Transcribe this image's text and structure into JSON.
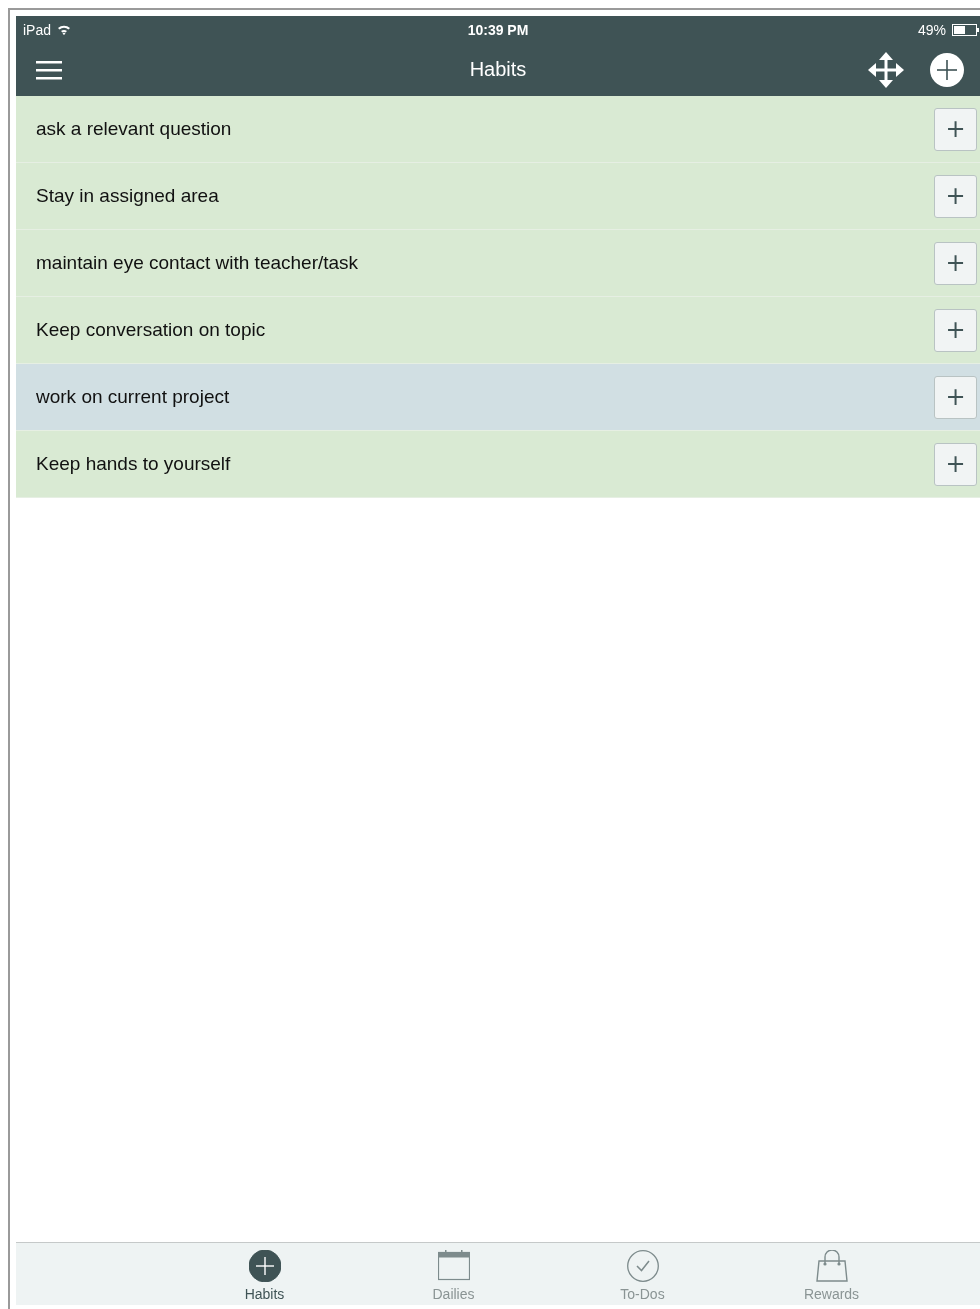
{
  "status_bar": {
    "device": "iPad",
    "time": "10:39 PM",
    "battery": "49%"
  },
  "nav_bar": {
    "title": "Habits"
  },
  "habits": [
    {
      "text": "ask a relevant question",
      "color": "#d9ead3",
      "button": "+"
    },
    {
      "text": "Stay in assigned area",
      "color": "#d9ead3",
      "button": "+"
    },
    {
      "text": "maintain eye contact with teacher/task",
      "color": "#d9ead3",
      "button": "+"
    },
    {
      "text": "Keep conversation on topic",
      "color": "#d9ead3",
      "button": "+"
    },
    {
      "text": "work on current project",
      "color": "#d1dfe3",
      "button": "+"
    },
    {
      "text": "Keep hands to yourself",
      "color": "#d9ead3",
      "button": "+"
    }
  ],
  "tab_bar": [
    {
      "label": "Habits",
      "kind": "habits",
      "selected": true
    },
    {
      "label": "Dailies",
      "kind": "dailies",
      "selected": false
    },
    {
      "label": "To-Dos",
      "kind": "todos",
      "selected": false
    },
    {
      "label": "Rewards",
      "kind": "rewards",
      "selected": false
    }
  ]
}
